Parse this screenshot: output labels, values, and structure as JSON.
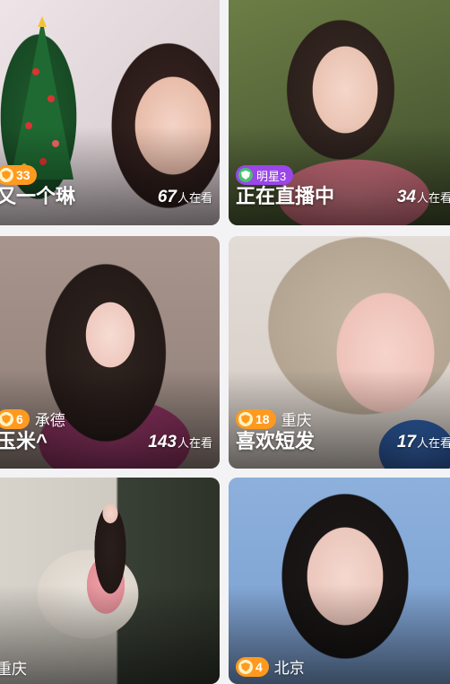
{
  "cards": [
    {
      "level": "33",
      "title": "又一个琳",
      "viewers": "67",
      "viewers_label": "人在看"
    },
    {
      "star_label": "明星3",
      "title": "正在直播中",
      "viewers": "34",
      "viewers_label": "人在看"
    },
    {
      "level": "6",
      "city": "承德",
      "title": "玉米^",
      "viewers": "143",
      "viewers_label": "人在看"
    },
    {
      "level": "18",
      "city": "重庆",
      "title": "喜欢短发",
      "viewers": "17",
      "viewers_label": "人在看"
    },
    {
      "city": "重庆"
    },
    {
      "level": "4",
      "city": "北京"
    }
  ],
  "colors": {
    "level_badge": "#ff9a1f",
    "star_badge": "#9a46e8",
    "background": "#f3f3f5"
  }
}
